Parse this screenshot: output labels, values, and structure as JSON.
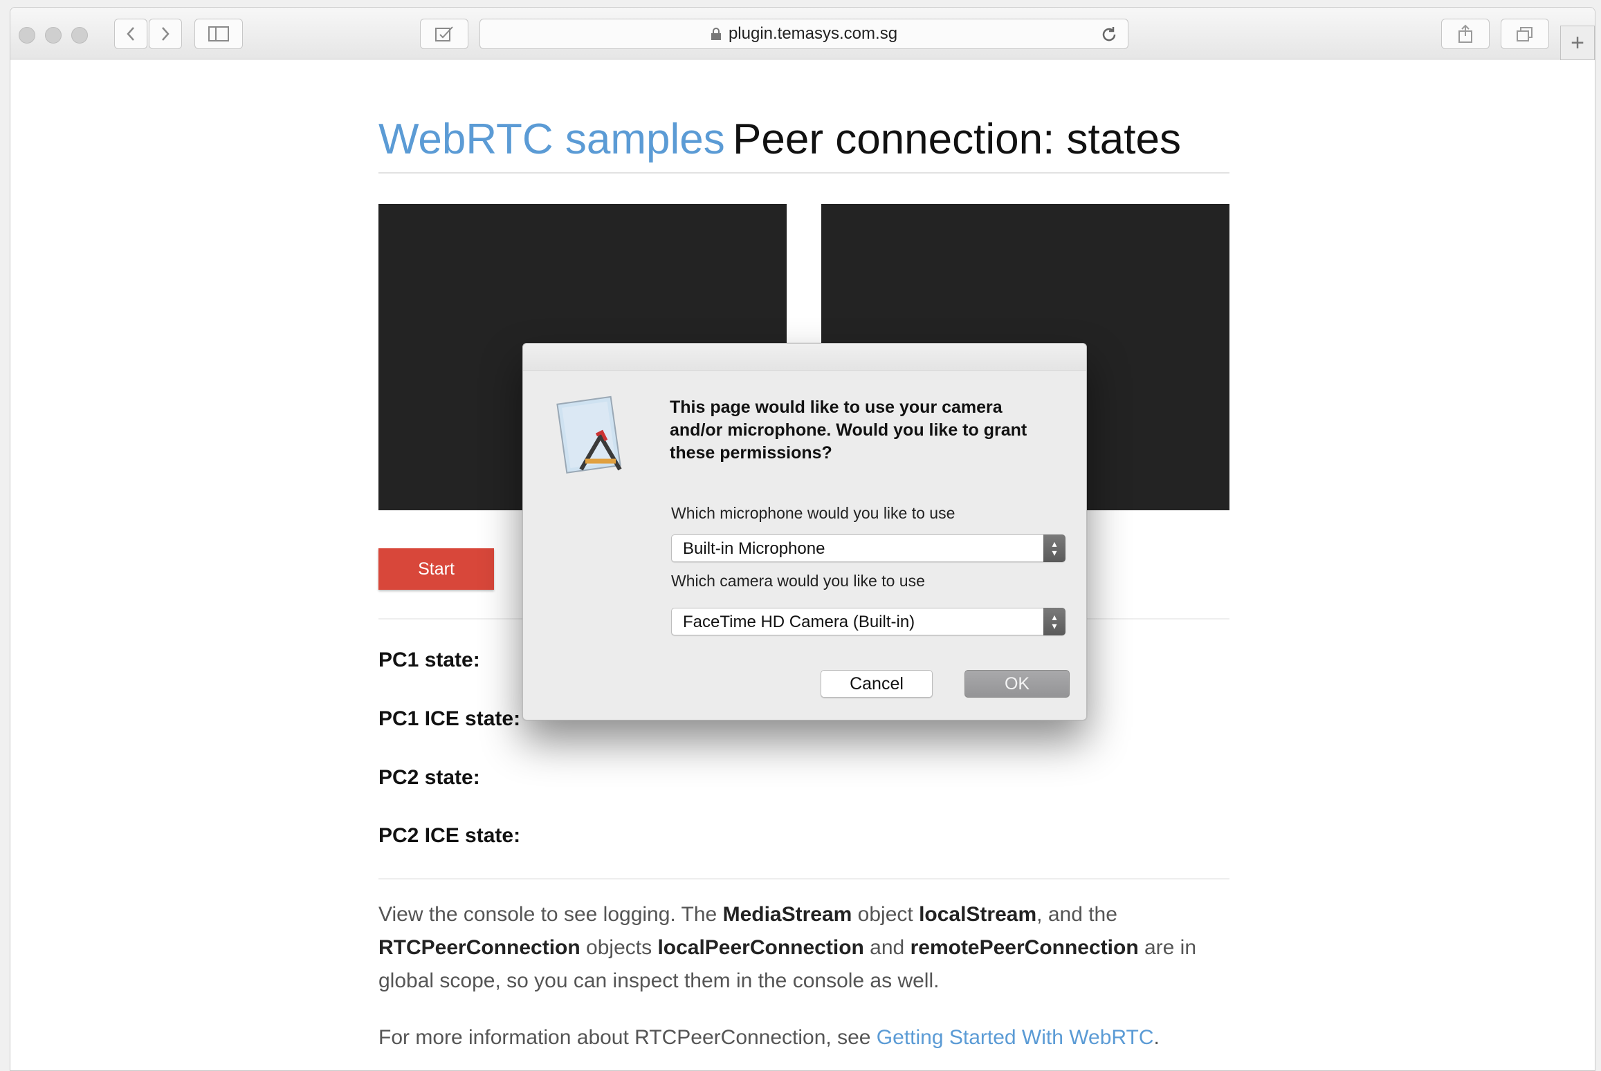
{
  "browser": {
    "url": "plugin.temasys.com.sg"
  },
  "page": {
    "title_link": "WebRTC samples",
    "title": "Peer connection: states",
    "start_button": "Start",
    "states": [
      {
        "label": "PC1 state:"
      },
      {
        "label": "PC1 ICE state:"
      },
      {
        "label": "PC2 state:"
      },
      {
        "label": "PC2 ICE state:"
      }
    ],
    "para1": {
      "t1": "View the console to see logging. The ",
      "b1": "MediaStream",
      "t2": " object ",
      "b2": "localStream",
      "t3": ", and the ",
      "b3": "RTCPeerConnection",
      "t4": " objects ",
      "b4": "localPeerConnection",
      "t5": " and ",
      "b5": "remotePeerConnection",
      "t6": " are in global scope, so you can inspect them in the console as well."
    },
    "para2": {
      "text": "For more information about RTCPeerConnection, see ",
      "link": "Getting Started With WebRTC",
      "end": "."
    }
  },
  "dialog": {
    "message": "This page would like to use your camera and/or microphone. Would you like to grant these permissions?",
    "mic_label": "Which microphone would you like to use",
    "mic_value": "Built-in Microphone",
    "camera_label": "Which camera would you like to use",
    "camera_value": "FaceTime HD Camera (Built-in)",
    "cancel": "Cancel",
    "ok": "OK"
  },
  "colors": {
    "link": "#5b9bd5",
    "start_button": "#d8473a",
    "video_bg": "#232323"
  },
  "icons": [
    "back-icon",
    "forward-icon",
    "sidebar-icon",
    "reader-icon",
    "lock-icon",
    "reload-icon",
    "share-icon",
    "tabs-icon",
    "plus-icon",
    "app-icon"
  ]
}
